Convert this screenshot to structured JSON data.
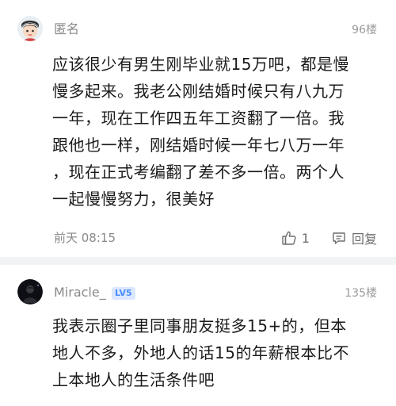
{
  "comments": [
    {
      "username": "匿名",
      "floor": "96楼",
      "lines": [
        "应该很少有男生刚毕业就15万吧，都是慢",
        "慢多起来。我老公刚结婚时候只有八九万",
        "一年，现在工作四五年工资翻了一倍。我",
        "跟他也一样，刚结婚时候一年七八万一年",
        "，现在正式考编翻了差不多一倍。两个人",
        "一起慢慢努力，很美好"
      ],
      "time": "前天 08:15",
      "like_count": "1",
      "reply_label": "回复",
      "avatar_icon": "anonymous-avatar-icon"
    },
    {
      "username": "Miracle_",
      "level": "LV5",
      "floor": "135楼",
      "lines": [
        "我表示圈子里同事朋友挺多15+的，但本",
        "地人不多，外地人的话15的年薪根本比不",
        "上本地人的生活条件吧"
      ],
      "avatar_icon": "user-photo-avatar-icon"
    }
  ],
  "colors": {
    "text": "#1a1a1a",
    "muted": "#8a8a8a",
    "level_badge_bg": "#dbe8ff",
    "level_badge_text": "#4a8cff",
    "divider": "#f2f3f5"
  }
}
